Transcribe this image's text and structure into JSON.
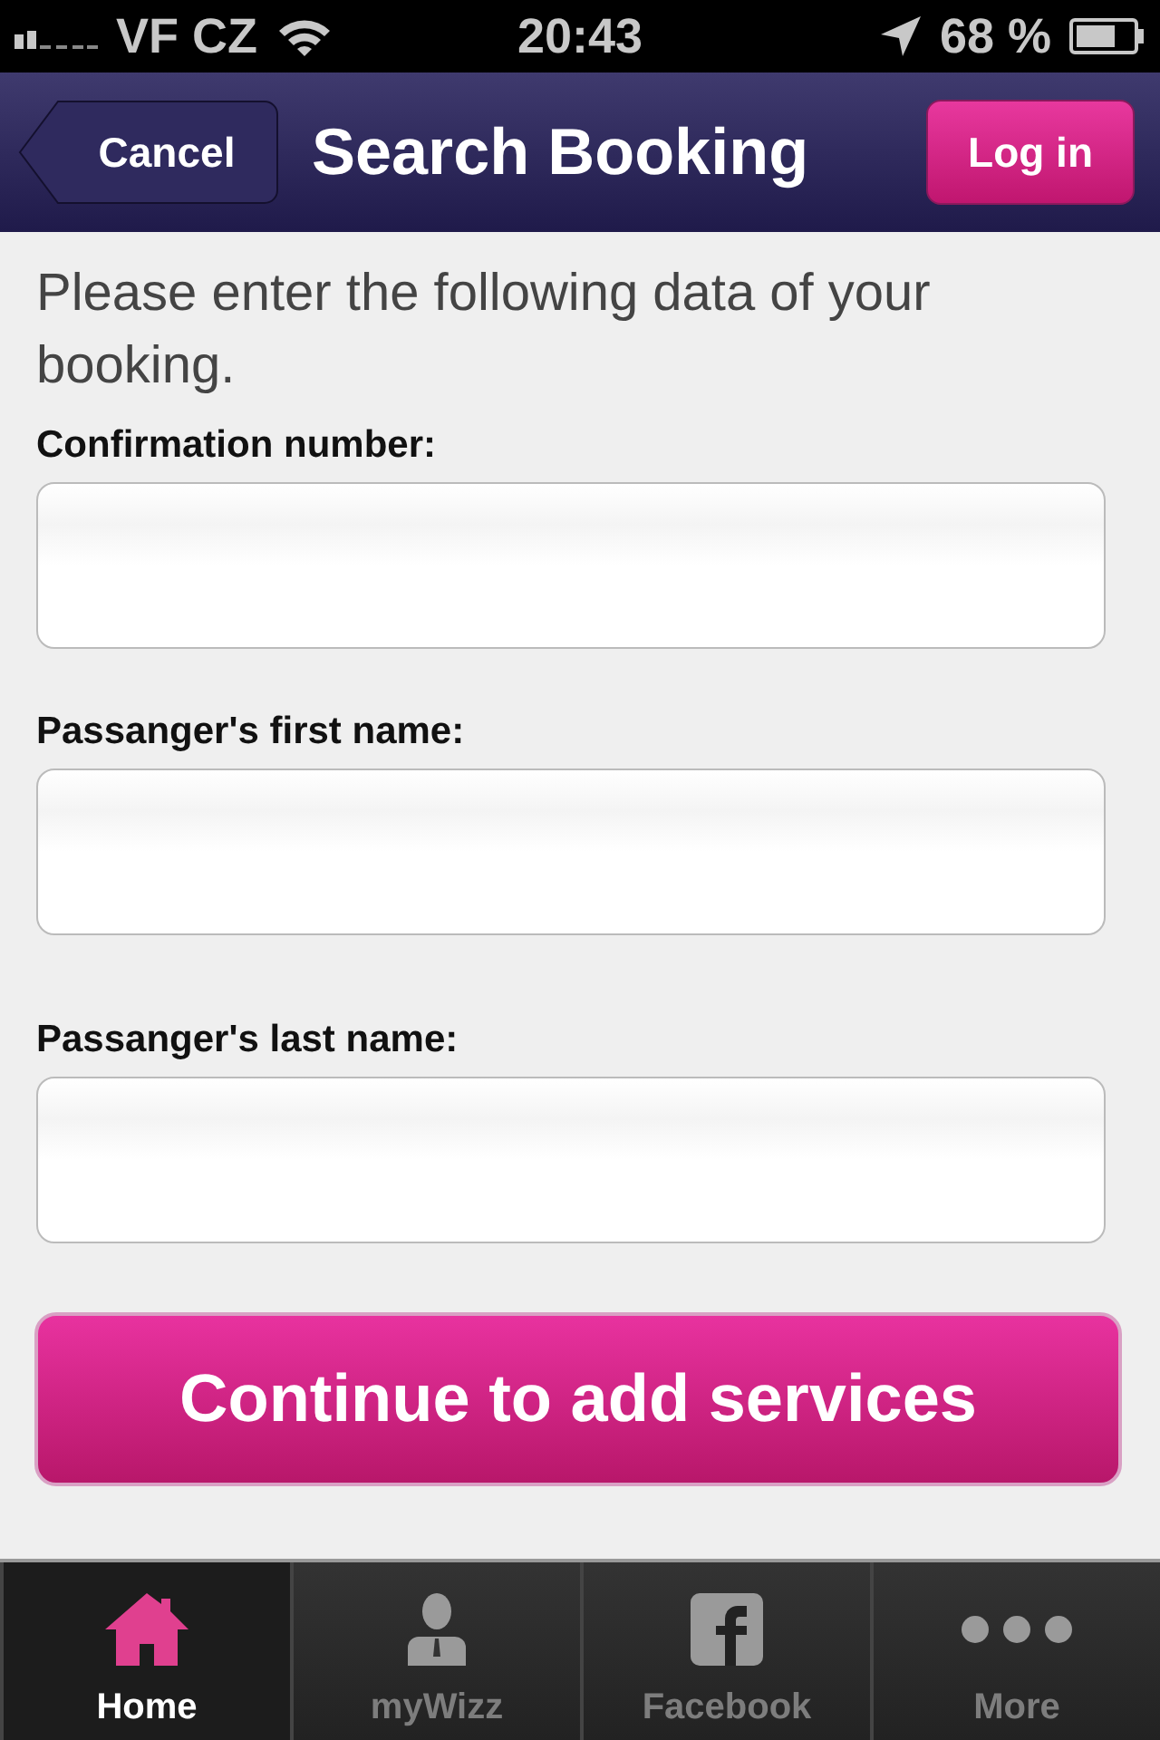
{
  "status_bar": {
    "carrier": "VF CZ",
    "time": "20:43",
    "battery": "68 %"
  },
  "nav_bar": {
    "back_button": "Cancel",
    "title": "Search Booking",
    "action_button": "Log in"
  },
  "intro": "Please enter the following data of your booking.",
  "fields": [
    {
      "label": "Confirmation number:"
    },
    {
      "label": "Passanger's first name:"
    },
    {
      "label": "Passanger's last name:"
    }
  ],
  "submit_button": "Continue to add services",
  "tab_bar": [
    {
      "kind": "home",
      "label": "Home",
      "selected": true
    },
    {
      "kind": "person",
      "label": "myWizz",
      "selected": false
    },
    {
      "kind": "facebook",
      "label": "Facebook",
      "selected": false
    },
    {
      "kind": "more",
      "label": "More",
      "selected": false
    }
  ]
}
